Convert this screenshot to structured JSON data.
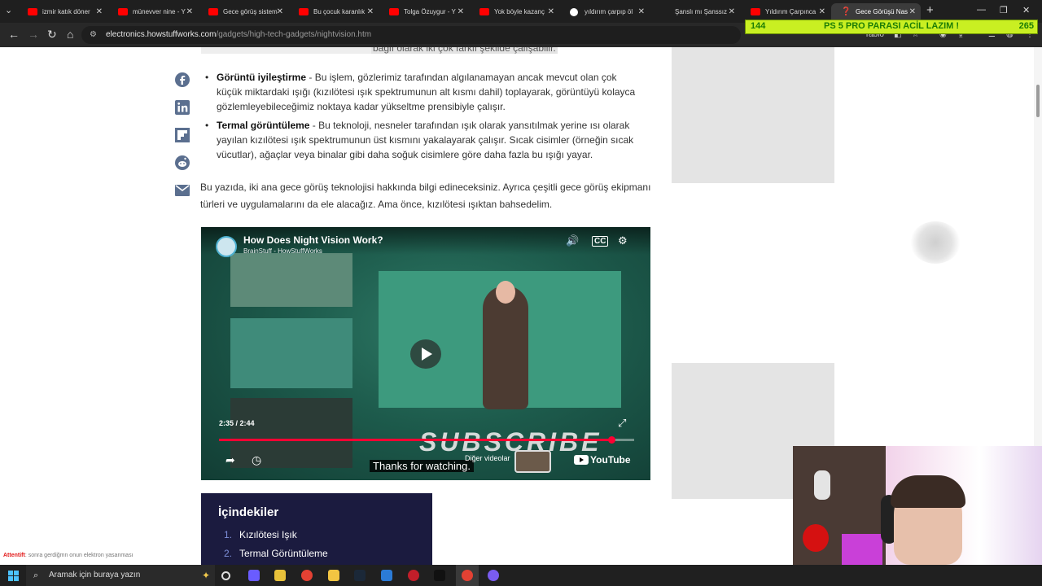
{
  "browser": {
    "tabs": [
      {
        "label": "izmir katık döner",
        "favicon": "youtube-icon"
      },
      {
        "label": "münevver nine - Y",
        "favicon": "youtube-icon"
      },
      {
        "label": "Gece görüş sistem",
        "favicon": "youtube-icon"
      },
      {
        "label": "Bu çocuk karanlık",
        "favicon": "youtube-icon"
      },
      {
        "label": "Tolga Özuygur - Y",
        "favicon": "youtube-icon"
      },
      {
        "label": "Yok böyle kazanç",
        "favicon": "youtube-icon"
      },
      {
        "label": "yıldırım çarpıp öl",
        "favicon": "google-icon"
      },
      {
        "label": "Şanslı mı Şanssız",
        "favicon": ""
      },
      {
        "label": "Yıldırım Çarpınca",
        "favicon": "youtube-icon"
      },
      {
        "label": "Gece Görüşü Nas",
        "favicon": "howstuffworks-icon"
      }
    ],
    "url_host": "electronics.howstuffworks.com",
    "url_path": "/gadgets/high-tech-gadgets/nightvision.htm",
    "toolbar_label": "Tablo"
  },
  "overlay": {
    "left": "144",
    "message": "PS 5 PRO PARASI ACİL LAZIM !",
    "right": "265"
  },
  "article": {
    "top_snippet": "bağlı olarak iki çok farklı şekilde çalışabilir.",
    "bullets": [
      {
        "term": "Görüntü iyileştirme",
        "text": " - Bu işlem, gözlerimiz tarafından algılanamayan ancak mevcut olan çok küçük miktardaki ışığı (kızılötesi ışık spektrumunun alt kısmı dahil) toplayarak, görüntüyü kolayca gözlemleyebileceğimiz noktaya kadar yükseltme prensibiyle çalışır."
      },
      {
        "term": "Termal görüntüleme",
        "text": " - Bu teknoloji, nesneler tarafından ışık olarak yansıtılmak yerine ısı olarak yayılan kızılötesi ışık spektrumunun üst kısmını yakalayarak çalışır. Sıcak cisimler (örneğin sıcak vücutlar), ağaçlar veya binalar gibi daha soğuk cisimlere göre daha fazla bu ışığı yayar."
      }
    ],
    "paragraph": "Bu yazıda, iki ana gece görüş teknolojisi hakkında bilgi edineceksiniz. Ayrıca çeşitli gece görüş ekipmanı türleri ve uygulamalarını da ele alacağız. Ama önce, kızılötesi ışıktan bahsedelim.",
    "share_icons": [
      "facebook-icon",
      "linkedin-icon",
      "flipboard-icon",
      "reddit-icon",
      "email-icon"
    ]
  },
  "video": {
    "title": "How Does Night Vision Work?",
    "channel": "BrainStuff - HowStuffWorks",
    "time": "2:35 / 2:44",
    "progress": 0.945,
    "overlay_text": "SUBSCRIBE",
    "caption": "Thanks for watching.",
    "more_videos": "Diğer videolar",
    "brand": "YouTube"
  },
  "toc": {
    "title": "İçindekiler",
    "items": [
      {
        "num": "1.",
        "label": "Kızılötesi Işık"
      },
      {
        "num": "2.",
        "label": "Termal Görüntüleme"
      }
    ]
  },
  "ticker": {
    "user": "Attentift",
    "text": ": sonra gerdiğmn onun elektron yasanması"
  },
  "taskbar": {
    "search_placeholder": "Aramak için buraya yazın"
  },
  "colors": {
    "accent_progress": "#ff0033",
    "toc_bg": "#1b1b3f",
    "overlay_bg": "#c9ef22"
  }
}
